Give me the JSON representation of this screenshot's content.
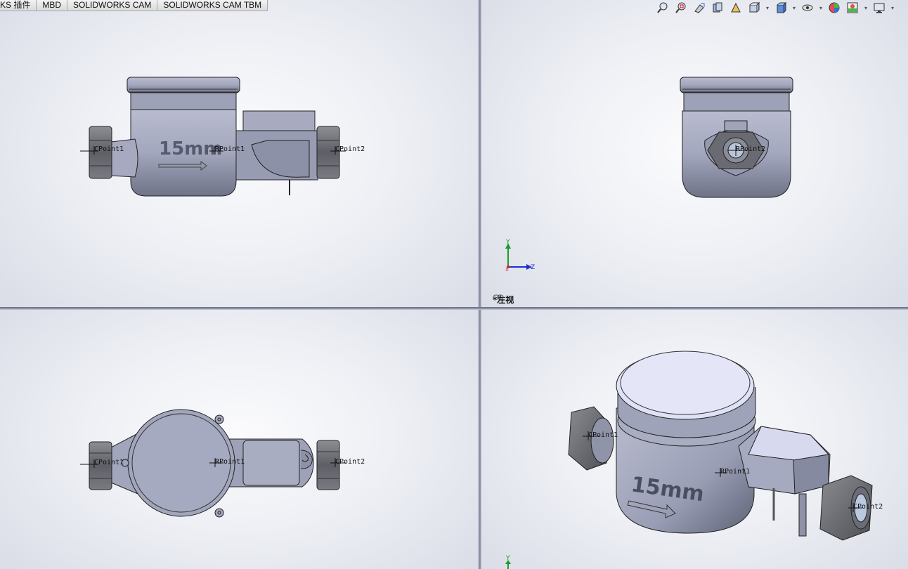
{
  "tabs": [
    "KS 插件",
    "MBD",
    "SOLIDWORKS CAM",
    "SOLIDWORKS CAM TBM"
  ],
  "toolbar_icons": [
    "zoom-to-fit-icon",
    "zoom-area-icon",
    "previous-view-icon",
    "section-view-icon",
    "dynamic-annotation-icon",
    "view-orientation-icon",
    "display-style-icon",
    "hide-show-items-icon",
    "edit-appearance-icon",
    "apply-scene-icon",
    "view-settings-icon"
  ],
  "model": {
    "size_text": "15mm",
    "points": {
      "p1": "CPoint1",
      "p2": "CPoint2",
      "p_mid": "RPoint1",
      "p_mid_right": "RPoint2"
    }
  },
  "triad": {
    "y": "Y",
    "z": "Z",
    "x": "X"
  },
  "views": {
    "top_right_label": "*左视"
  },
  "colors": {
    "background": "#eef0f5",
    "part": "#a2a6bc",
    "part_dark": "#5f6275",
    "nut": "#6e6f75",
    "axis_y": "#1f9a2a",
    "axis_z": "#1c2fd6",
    "axis_x": "#d42020"
  }
}
